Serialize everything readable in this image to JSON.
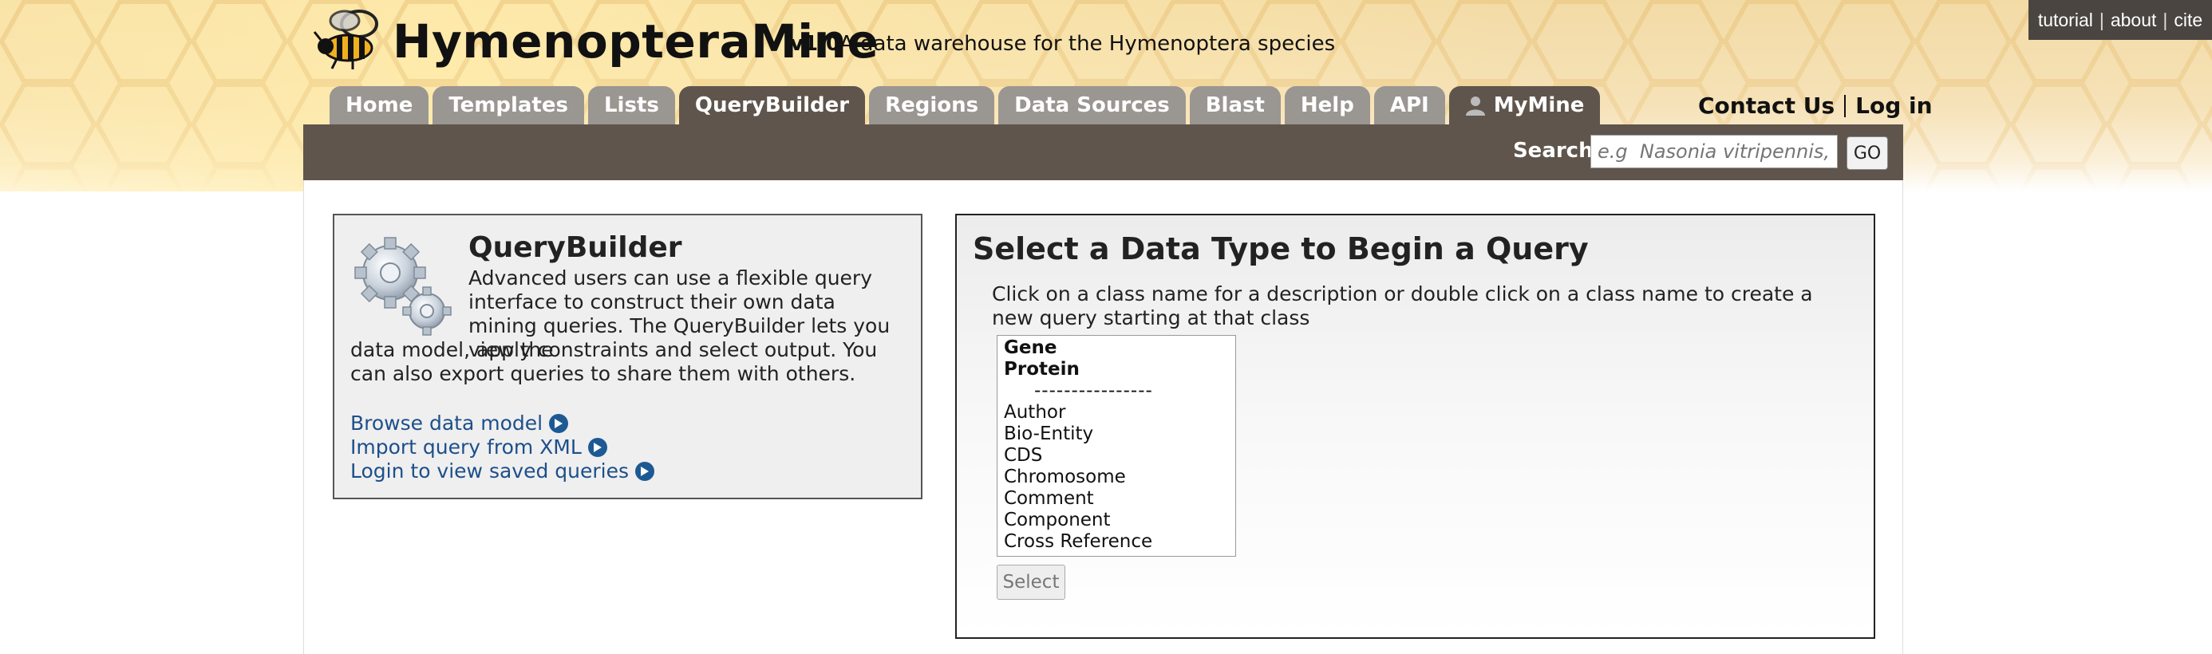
{
  "header": {
    "title": "HymenopteraMine",
    "version": "v1.0",
    "tagline": "A data warehouse for the Hymenoptera species",
    "top_links": [
      "tutorial",
      "|",
      "about",
      "|",
      "cite"
    ],
    "contact_label": "Contact Us",
    "login_label": "Log in"
  },
  "tabs": [
    {
      "label": "Home",
      "active": false
    },
    {
      "label": "Templates",
      "active": false
    },
    {
      "label": "Lists",
      "active": false
    },
    {
      "label": "QueryBuilder",
      "active": true
    },
    {
      "label": "Regions",
      "active": false
    },
    {
      "label": "Data Sources",
      "active": false
    },
    {
      "label": "Blast",
      "active": false
    },
    {
      "label": "Help",
      "active": false
    },
    {
      "label": "API",
      "active": false
    },
    {
      "label": "MyMine",
      "active": false
    }
  ],
  "search": {
    "label": "Search:",
    "placeholder": "e.g  Nasonia vitripennis, A",
    "button": "GO"
  },
  "querybuilder_panel": {
    "title": "QueryBuilder",
    "description_top": "Advanced users can use a flexible query interface to construct their own data mining queries. The QueryBuilder lets you view the",
    "description_bottom": "data model, apply constraints and select output. You can also export queries to share them with others.",
    "links": [
      "Browse data model",
      "Import query from XML",
      "Login to view saved queries"
    ]
  },
  "select_panel": {
    "title": "Select a Data Type to Begin a Query",
    "instructions": "Click on a class name for a description or double click on a class name to create a new query starting at that class",
    "classes_bold": [
      "Gene",
      "Protein"
    ],
    "divider": "----------------",
    "classes": [
      "Author",
      "Bio-Entity",
      "CDS",
      "Chromosome",
      "Comment",
      "Component",
      "Cross Reference"
    ],
    "select_button": "Select"
  },
  "colors": {
    "tab_bg": "#9a9692",
    "tab_active_bg": "#5f554c",
    "search_bar_bg": "#5f554c",
    "link_color": "#1d4f8a"
  }
}
